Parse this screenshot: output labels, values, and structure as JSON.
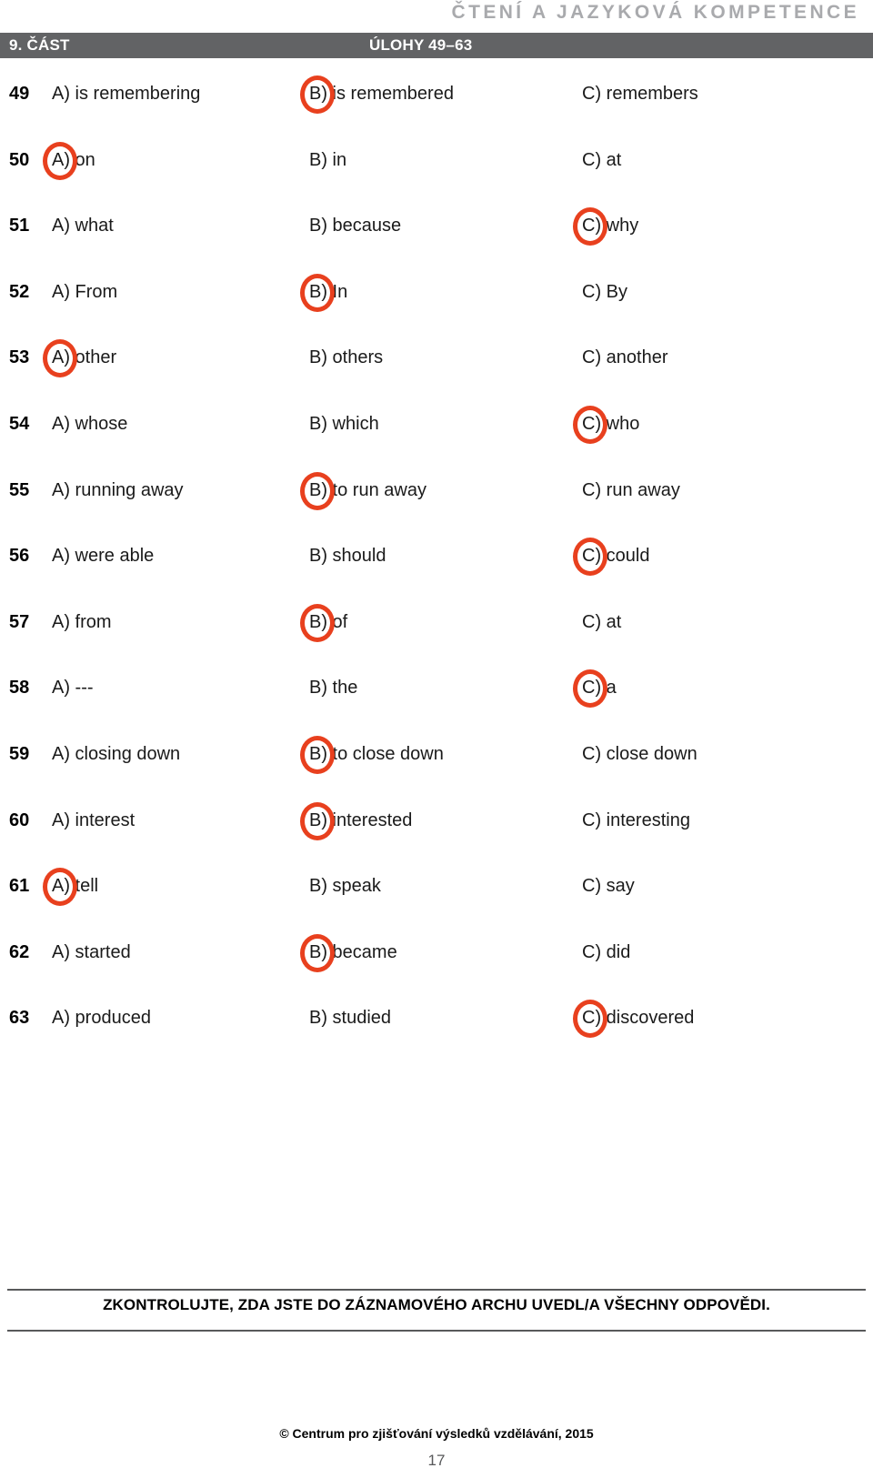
{
  "header": {
    "section_title": "ČTENÍ A JAZYKOVÁ KOMPETENCE",
    "part_label": "9. ČÁST",
    "tasks_label": "ÚLOHY 49–63",
    "bar_color": "#626365",
    "section_title_color": "#a9aaad"
  },
  "annotation": {
    "circle_color": "#e8401e",
    "style": "hand-drawn-ellipse"
  },
  "questions": [
    {
      "number": "49",
      "a": "A) is remembering",
      "b": "B) is remembered",
      "c": "C) remembers",
      "marked": "b"
    },
    {
      "number": "50",
      "a": "A) on",
      "b": "B) in",
      "c": "C) at",
      "marked": "a"
    },
    {
      "number": "51",
      "a": "A) what",
      "b": "B) because",
      "c": "C) why",
      "marked": "c"
    },
    {
      "number": "52",
      "a": "A) From",
      "b": "B) In",
      "c": "C) By",
      "marked": "b"
    },
    {
      "number": "53",
      "a": "A) other",
      "b": "B) others",
      "c": "C) another",
      "marked": "a"
    },
    {
      "number": "54",
      "a": "A) whose",
      "b": "B) which",
      "c": "C) who",
      "marked": "c"
    },
    {
      "number": "55",
      "a": "A) running away",
      "b": "B) to run away",
      "c": "C) run away",
      "marked": "b"
    },
    {
      "number": "56",
      "a": "A) were able",
      "b": "B) should",
      "c": "C) could",
      "marked": "c"
    },
    {
      "number": "57",
      "a": "A) from",
      "b": "B) of",
      "c": "C) at",
      "marked": "b"
    },
    {
      "number": "58",
      "a": "A) ---",
      "b": "B) the",
      "c": "C) a",
      "marked": "c"
    },
    {
      "number": "59",
      "a": "A) closing down",
      "b": "B) to close down",
      "c": "C) close down",
      "marked": "b"
    },
    {
      "number": "60",
      "a": "A) interest",
      "b": "B) interested",
      "c": "C) interesting",
      "marked": "b"
    },
    {
      "number": "61",
      "a": "A) tell",
      "b": "B) speak",
      "c": "C) say",
      "marked": "a"
    },
    {
      "number": "62",
      "a": "A) started",
      "b": "B) became",
      "c": "C) did",
      "marked": "b"
    },
    {
      "number": "63",
      "a": "A) produced",
      "b": "B) studied",
      "c": "C) discovered",
      "marked": "c"
    }
  ],
  "footer": {
    "notice": "ZKONTROLUJTE, ZDA JSTE DO ZÁZNAMOVÉHO ARCHU UVEDL/A VŠECHNY ODPOVĚDI.",
    "copyright": "© Centrum pro zjišťování výsledků vzdělávání, 2015",
    "page_number": "17"
  }
}
